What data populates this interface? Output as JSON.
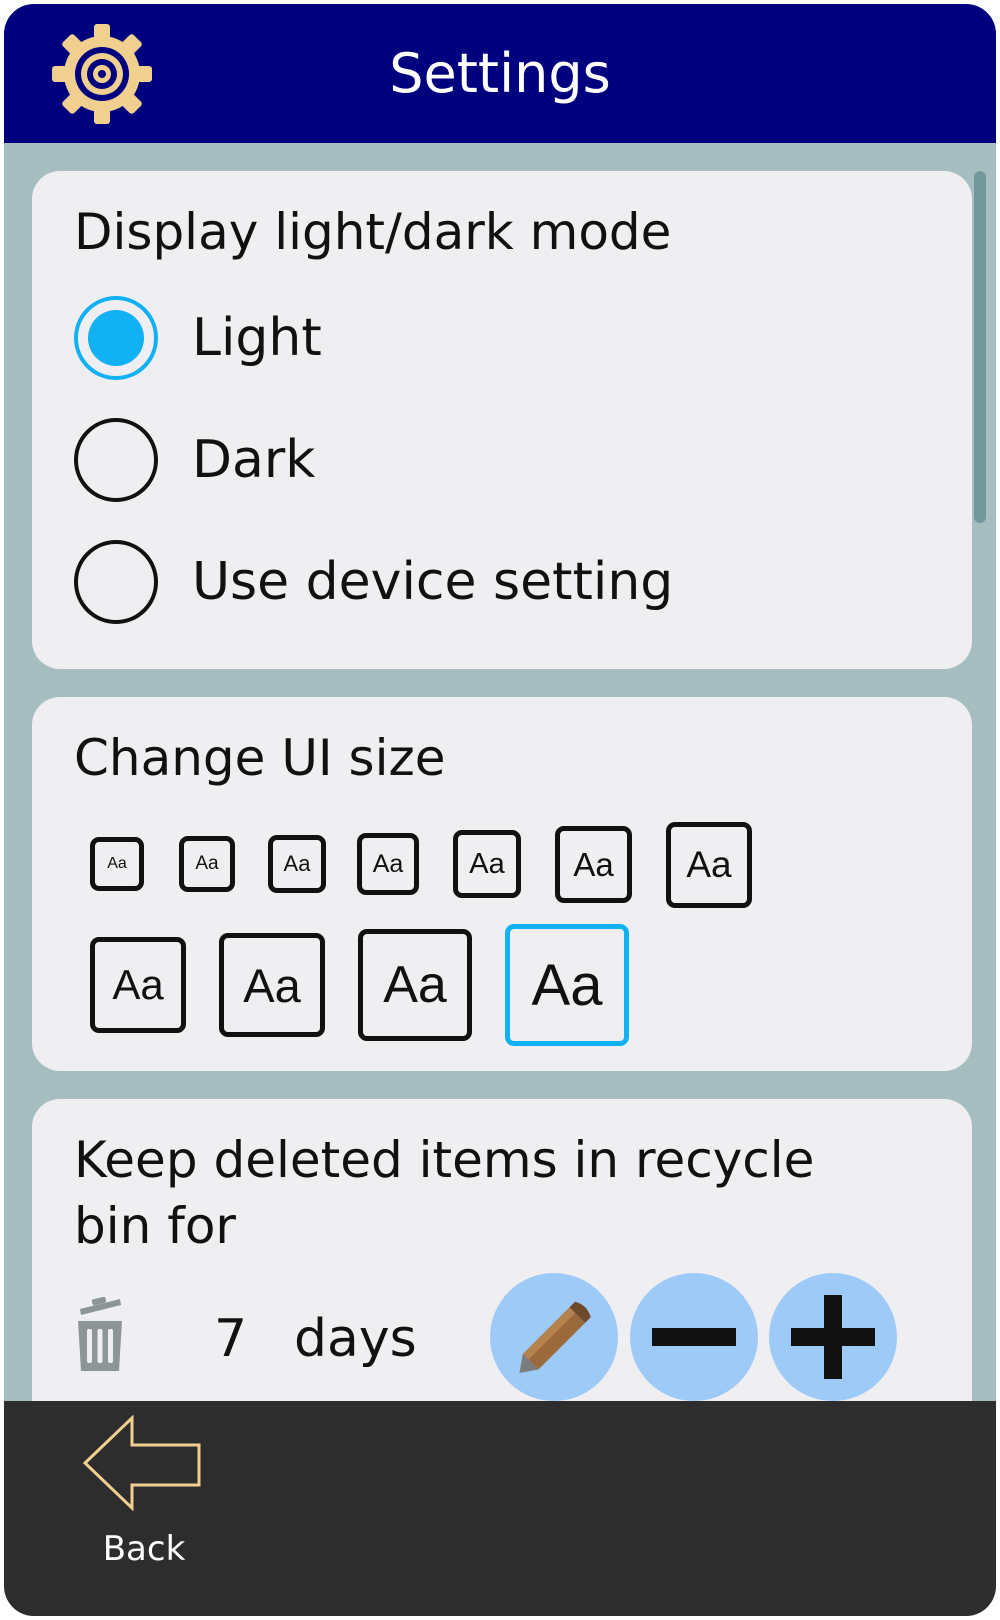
{
  "header": {
    "title": "Settings",
    "icon": "gear-icon",
    "icon_color": "#f1d08f",
    "background": "#00007f"
  },
  "theme_mode": {
    "title": "Display light/dark mode",
    "options": [
      {
        "label": "Light",
        "selected": true
      },
      {
        "label": "Dark",
        "selected": false
      },
      {
        "label": "Use device setting",
        "selected": false
      }
    ],
    "accent_color": "#11b1f4"
  },
  "ui_size": {
    "title": "Change UI size",
    "sample_label": "Aa",
    "option_count": 11,
    "selected_index": 10
  },
  "recycle_bin": {
    "title": "Keep deleted items in recycle bin for",
    "value": "7",
    "unit": "days",
    "icons": [
      "trash-icon",
      "pencil-icon",
      "minus-icon",
      "plus-icon"
    ]
  },
  "footer": {
    "back_label": "Back",
    "back_icon": "arrow-left-icon"
  }
}
